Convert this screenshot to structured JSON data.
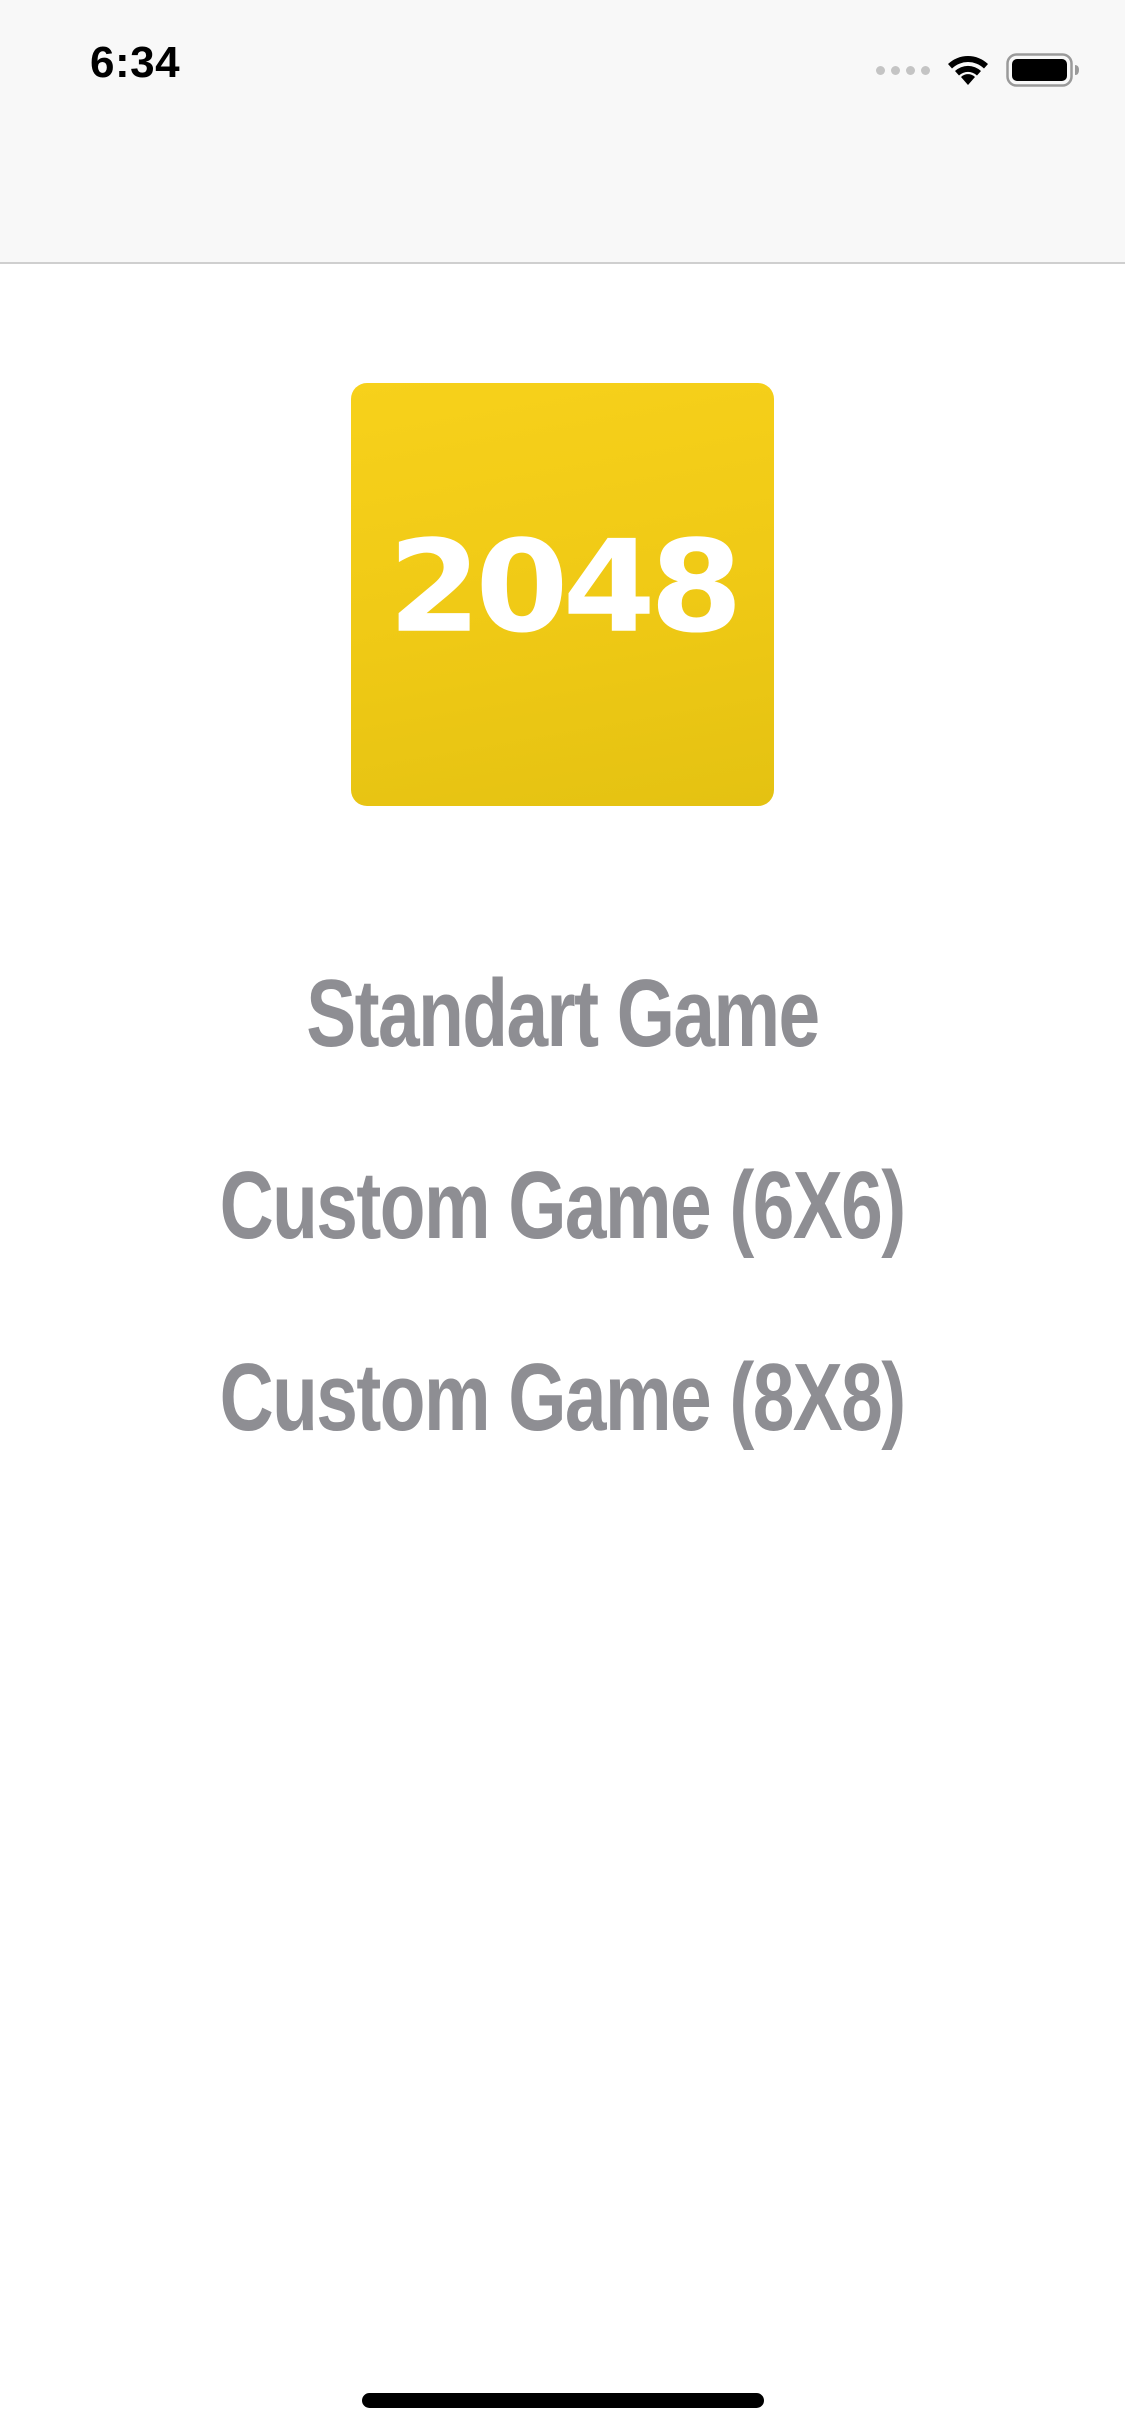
{
  "status_bar": {
    "time": "6:34",
    "icons": [
      "signal-dots-icon",
      "wifi-icon",
      "battery-icon"
    ]
  },
  "logo": {
    "text": "2048",
    "color": "#f4cd17"
  },
  "menu": {
    "items": [
      {
        "label": "Standart Game"
      },
      {
        "label": "Custom Game (6X6)"
      },
      {
        "label": "Custom Game (8X8)"
      }
    ],
    "text_color": "#8e8e93"
  },
  "colors": {
    "nav_background": "#f8f8f8",
    "background": "#ffffff",
    "logo_yellow": "#f4cd17"
  }
}
